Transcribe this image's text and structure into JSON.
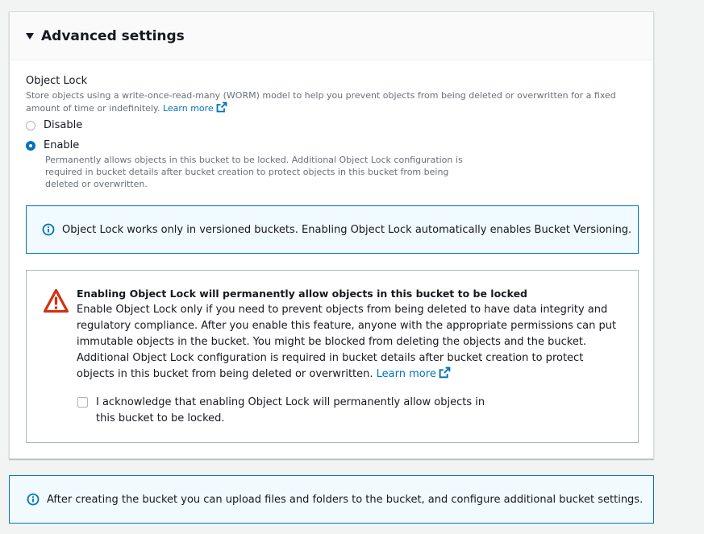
{
  "advanced_settings": {
    "title": "Advanced settings"
  },
  "object_lock": {
    "label": "Object Lock",
    "description": "Store objects using a write-once-read-many (WORM) model to help you prevent objects from being deleted or overwritten for a fixed amount of time or indefinitely.",
    "learn_more": "Learn more",
    "options": [
      {
        "label": "Disable",
        "selected": false
      },
      {
        "label": "Enable",
        "selected": true
      }
    ],
    "enable_description": "Permanently allows objects in this bucket to be locked. Additional Object Lock configuration is required in bucket details after bucket creation to protect objects in this bucket from being deleted or overwritten."
  },
  "versioning_info": {
    "text": "Object Lock works only in versioned buckets. Enabling Object Lock automatically enables Bucket Versioning.",
    "icon": "info-icon"
  },
  "warning": {
    "title": "Enabling Object Lock will permanently allow objects in this bucket to be locked",
    "body": "Enable Object Lock only if you need to prevent objects from being deleted to have data integrity and regulatory compliance. After you enable this feature, anyone with the appropriate permissions can put immutable objects in the bucket. You might be blocked from deleting the objects and the bucket. Additional Object Lock configuration is required in bucket details after bucket creation to protect objects in this bucket from being deleted or overwritten.",
    "learn_more": "Learn more",
    "icon": "warning-icon",
    "acknowledge_label": "I acknowledge that enabling Object Lock will permanently allow objects in this bucket to be locked.",
    "acknowledged": false
  },
  "footer_info": {
    "text": "After creating the bucket you can upload files and folders to the bucket, and configure additional bucket settings.",
    "icon": "info-icon"
  },
  "colors": {
    "link": "#0073bb",
    "info_bg": "#f1faff",
    "warning_red": "#d13212",
    "text": "#16191f",
    "secondary_text": "#687078"
  }
}
